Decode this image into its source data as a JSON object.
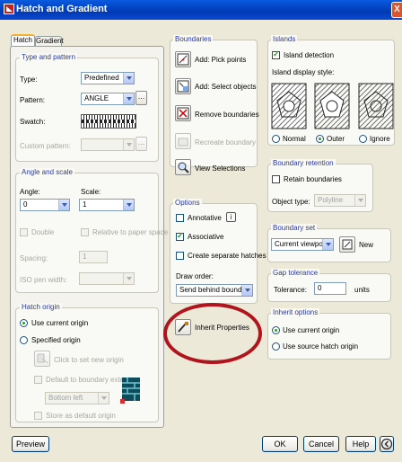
{
  "window": {
    "title": "Hatch and Gradient",
    "close_glyph": "X"
  },
  "tabs": [
    {
      "label": "Hatch",
      "active": true
    },
    {
      "label": "Gradient",
      "active": false
    }
  ],
  "type_pattern": {
    "heading": "Type and pattern",
    "type_label": "Type:",
    "type_value": "Predefined",
    "pattern_label": "Pattern:",
    "pattern_value": "ANGLE",
    "swatch_label": "Swatch:",
    "custom_label": "Custom pattern:"
  },
  "angle_scale": {
    "heading": "Angle and scale",
    "angle_label": "Angle:",
    "angle_value": "0",
    "scale_label": "Scale:",
    "scale_value": "1",
    "double_label": "Double",
    "relative_label": "Relative to paper space",
    "spacing_label": "Spacing:",
    "spacing_value": "1",
    "iso_label": "ISO pen width:"
  },
  "hatch_origin": {
    "heading": "Hatch origin",
    "use_current": "Use current origin",
    "specified": "Specified origin",
    "click_set": "Click to set new origin",
    "default_extents": "Default to boundary extents",
    "position_value": "Bottom left",
    "store_default": "Store as default origin"
  },
  "boundaries": {
    "heading": "Boundaries",
    "add_pick": "Add: Pick points",
    "add_select": "Add: Select objects",
    "remove": "Remove boundaries",
    "recreate": "Recreate boundary",
    "view_selections": "View Selections"
  },
  "options": {
    "heading": "Options",
    "annotative": "Annotative",
    "info_glyph": "i",
    "associative": "Associative",
    "separate": "Create separate hatches",
    "draw_order_label": "Draw order:",
    "draw_order_value": "Send behind boundary"
  },
  "inherit": {
    "label": "Inherit Properties"
  },
  "islands": {
    "heading": "Islands",
    "detection": "Island detection",
    "style_label": "Island display style:",
    "normal": "Normal",
    "outer": "Outer",
    "ignore": "Ignore"
  },
  "retention": {
    "heading": "Boundary retention",
    "retain": "Retain boundaries",
    "object_type_label": "Object type:",
    "object_type_value": "Polyline"
  },
  "boundary_set": {
    "heading": "Boundary set",
    "value": "Current viewport",
    "new_label": "New"
  },
  "gap": {
    "heading": "Gap tolerance",
    "tolerance_label": "Tolerance:",
    "tolerance_value": "0",
    "units": "units"
  },
  "inherit_options": {
    "heading": "Inherit options",
    "use_current": "Use current origin",
    "use_source": "Use source hatch origin"
  },
  "footer": {
    "preview": "Preview",
    "ok": "OK",
    "cancel": "Cancel",
    "help": "Help"
  },
  "colors": {
    "title_bar": "#0039b5",
    "group_label": "#2a3aa0",
    "annotation_circle": "#b0141c"
  }
}
